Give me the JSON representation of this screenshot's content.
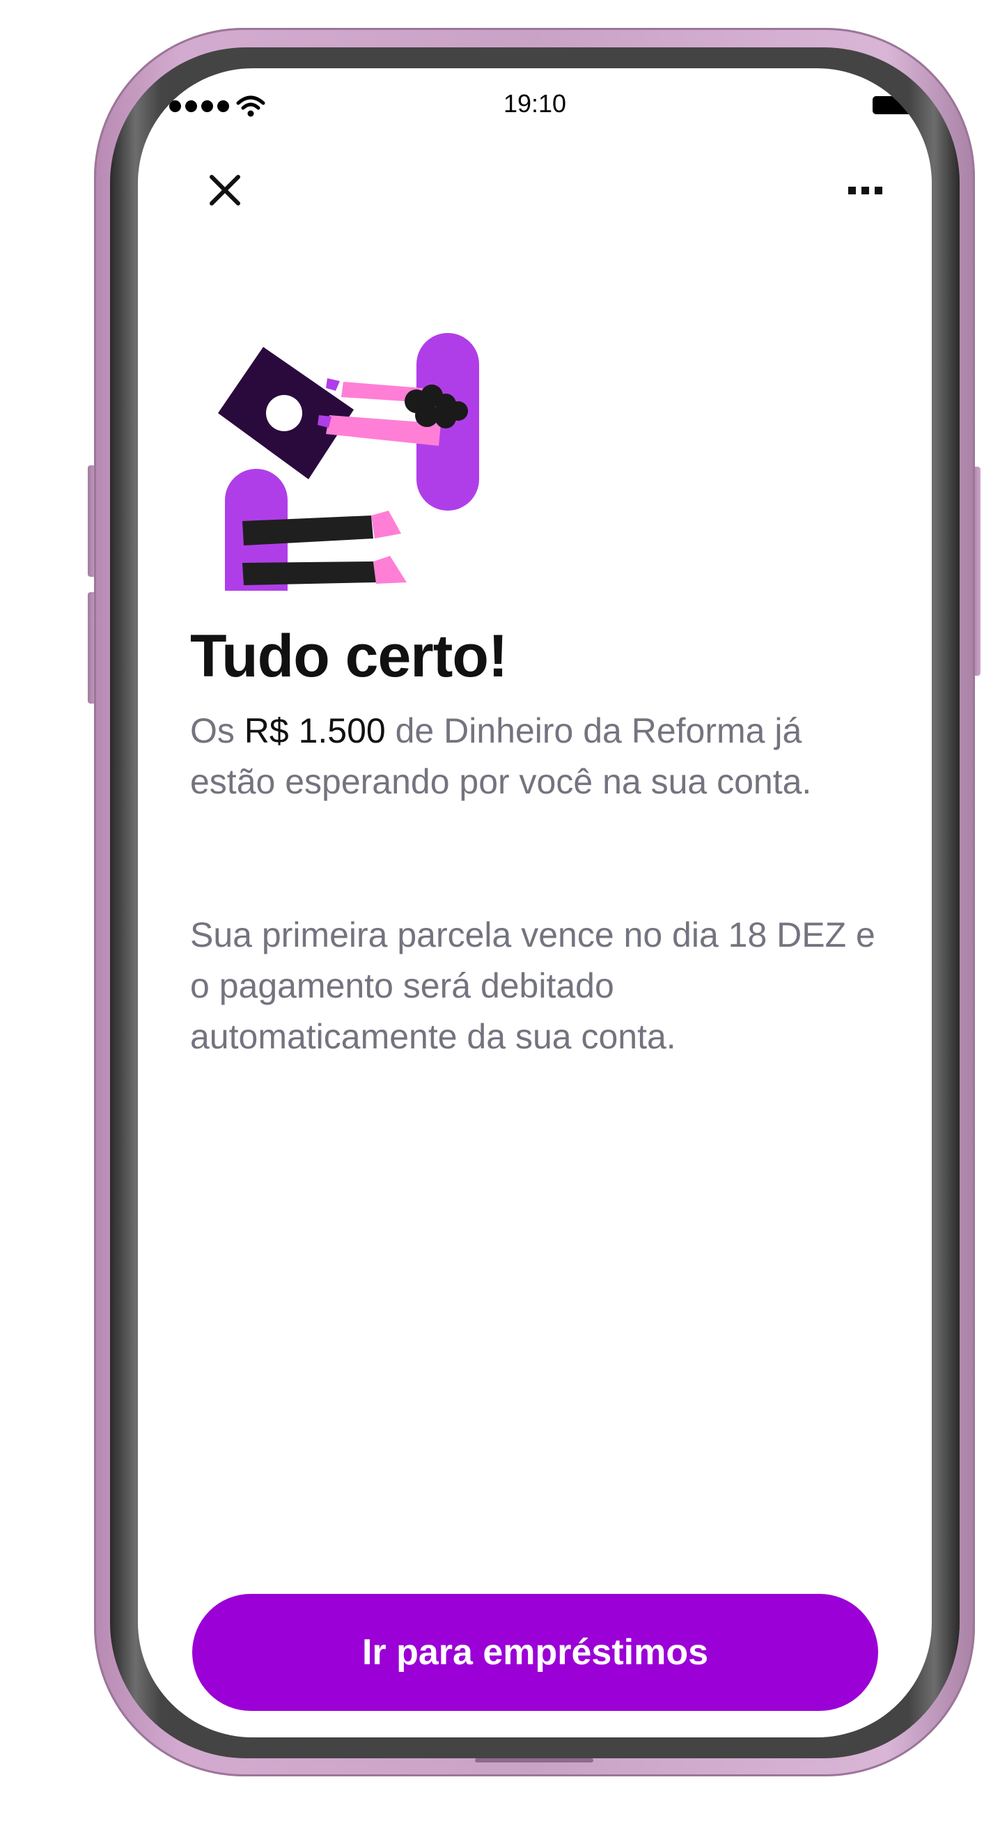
{
  "status_bar": {
    "time": "19:10"
  },
  "toolbar": {
    "close_icon": "close-icon",
    "more_icon": "more-horizontal-icon"
  },
  "content": {
    "title": "Tudo certo!",
    "paragraph1_prefix": "Os ",
    "paragraph1_amount": "R$ 1.500",
    "paragraph1_suffix": " de Dinheiro da Reforma já estão esperando por você na sua conta.",
    "paragraph2": "Sua primeira parcela vence no dia 18 DEZ e o pagamento será debitado automaticamente da sua conta."
  },
  "cta": {
    "label": "Ir para empréstimos"
  },
  "colors": {
    "accent": "#9b00d6",
    "illustration_purple": "#b03ee8",
    "illustration_dark": "#2a0a3d",
    "illustration_pink": "#ff7fd6",
    "body_text": "#747480",
    "frame": "#c9a3c6"
  }
}
